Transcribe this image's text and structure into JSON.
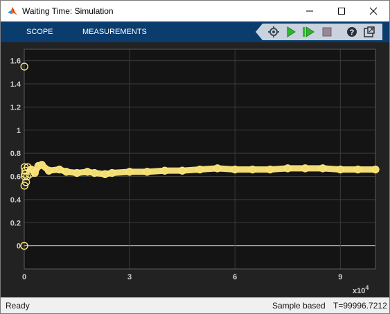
{
  "window": {
    "title": "Waiting Time: Simulation",
    "icon": "matlab-logo-icon"
  },
  "toolstrip": {
    "tabs": [
      "SCOPE",
      "MEASUREMENTS"
    ],
    "tools": [
      "configure-icon",
      "run-icon",
      "step-forward-icon",
      "stop-icon",
      "help-icon",
      "undock-icon"
    ]
  },
  "status": {
    "state": "Ready",
    "mode": "Sample based",
    "time": "T=99996.7212"
  },
  "colors": {
    "trace": "#fde77a",
    "axes_background": "#141414",
    "figure_background": "#222222",
    "toolstrip": "#0a3c6e"
  },
  "chart_data": {
    "type": "scatter",
    "title": "",
    "xlabel": "",
    "ylabel": "",
    "x_multiplier": "x10",
    "x_multiplier_exponent": "4",
    "xlim": [
      0,
      10
    ],
    "ylim": [
      -0.2,
      1.7
    ],
    "xticks": [
      "0",
      "3",
      "6",
      "9"
    ],
    "yticks": [
      "0",
      "0.2",
      "0.4",
      "0.6",
      "0.8",
      "1",
      "1.2",
      "1.4",
      "1.6"
    ],
    "grid": true,
    "legend": "none",
    "series": [
      {
        "marker": "circle",
        "x": [
          0,
          0.003,
          0.006,
          0.01,
          0.015,
          0.02,
          0.03,
          0.05,
          0.08,
          0.1,
          0.15,
          0.2,
          0.3,
          0.4,
          0.5,
          0.7,
          1.0,
          1.2,
          1.5,
          1.8,
          2.0,
          2.3,
          2.5,
          3.0,
          3.5,
          4.0,
          4.5,
          5.0,
          5.5,
          6.0,
          6.5,
          7.0,
          7.5,
          8.0,
          8.5,
          9.0,
          9.5,
          10.0
        ],
        "y": [
          0,
          1.55,
          0.52,
          0.68,
          0.6,
          0.62,
          0.65,
          0.55,
          0.6,
          0.68,
          0.62,
          0.66,
          0.63,
          0.69,
          0.7,
          0.65,
          0.66,
          0.64,
          0.63,
          0.64,
          0.63,
          0.62,
          0.63,
          0.64,
          0.64,
          0.65,
          0.65,
          0.66,
          0.67,
          0.66,
          0.66,
          0.66,
          0.67,
          0.67,
          0.67,
          0.66,
          0.66,
          0.66
        ]
      }
    ]
  }
}
